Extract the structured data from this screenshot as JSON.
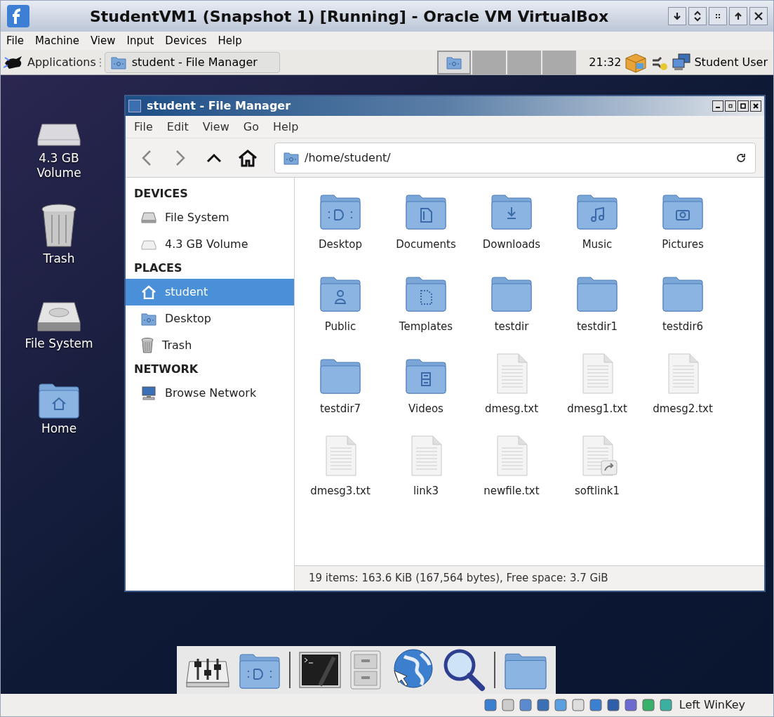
{
  "window": {
    "title": "StudentVM1 (Snapshot 1) [Running] - Oracle VM VirtualBox"
  },
  "menu": [
    "File",
    "Machine",
    "View",
    "Input",
    "Devices",
    "Help"
  ],
  "panel": {
    "applications": "Applications",
    "tasks": [
      {
        "label": "student - File Manager",
        "selected": false
      }
    ],
    "workspaces": [
      {
        "selected": true
      },
      {
        "selected": false
      },
      {
        "selected": false
      },
      {
        "selected": false
      }
    ],
    "clock": "21:32",
    "user": "Student User"
  },
  "desktop_icons": [
    {
      "label": "4.3 GB Volume",
      "kind": "volume"
    },
    {
      "label": "Trash",
      "kind": "trash"
    },
    {
      "label": "File System",
      "kind": "drive"
    },
    {
      "label": "Home",
      "kind": "home"
    }
  ],
  "file_manager": {
    "title": "student - File Manager",
    "menu": [
      "File",
      "Edit",
      "View",
      "Go",
      "Help"
    ],
    "path": "/home/student/",
    "sidebar": [
      {
        "heading": "DEVICES",
        "items": [
          {
            "label": "File System",
            "kind": "drive",
            "selected": false
          },
          {
            "label": "4.3 GB Volume",
            "kind": "volume",
            "selected": false
          }
        ]
      },
      {
        "heading": "PLACES",
        "items": [
          {
            "label": "student",
            "kind": "home",
            "selected": true
          },
          {
            "label": "Desktop",
            "kind": "desktop",
            "selected": false
          },
          {
            "label": "Trash",
            "kind": "trash",
            "selected": false
          }
        ]
      },
      {
        "heading": "NETWORK",
        "items": [
          {
            "label": "Browse Network",
            "kind": "network",
            "selected": false
          }
        ]
      }
    ],
    "files": [
      {
        "name": "Desktop",
        "kind": "desktop"
      },
      {
        "name": "Documents",
        "kind": "documents"
      },
      {
        "name": "Downloads",
        "kind": "downloads"
      },
      {
        "name": "Music",
        "kind": "music"
      },
      {
        "name": "Pictures",
        "kind": "pictures"
      },
      {
        "name": "Public",
        "kind": "public"
      },
      {
        "name": "Templates",
        "kind": "templates"
      },
      {
        "name": "testdir",
        "kind": "folder"
      },
      {
        "name": "testdir1",
        "kind": "folder"
      },
      {
        "name": "testdir6",
        "kind": "folder"
      },
      {
        "name": "testdir7",
        "kind": "folder"
      },
      {
        "name": "Videos",
        "kind": "videos"
      },
      {
        "name": "dmesg.txt",
        "kind": "text"
      },
      {
        "name": "dmesg1.txt",
        "kind": "text"
      },
      {
        "name": "dmesg2.txt",
        "kind": "text"
      },
      {
        "name": "dmesg3.txt",
        "kind": "text"
      },
      {
        "name": "link3",
        "kind": "text"
      },
      {
        "name": "newfile.txt",
        "kind": "text"
      },
      {
        "name": "softlink1",
        "kind": "link"
      }
    ],
    "status": "19 items: 163.6 KiB (167,564 bytes), Free space: 3.7 GiB"
  },
  "dock": [
    {
      "kind": "mixer"
    },
    {
      "kind": "desktop"
    },
    {
      "kind": "separator"
    },
    {
      "kind": "terminal"
    },
    {
      "kind": "cabinet"
    },
    {
      "kind": "globe"
    },
    {
      "kind": "search"
    },
    {
      "kind": "separator"
    },
    {
      "kind": "folder"
    }
  ],
  "host_status": {
    "key": "Left WinKey"
  }
}
